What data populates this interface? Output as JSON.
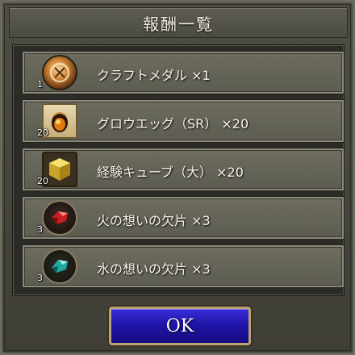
{
  "dialog": {
    "title": "報酬一覧",
    "ok_label": "OK"
  },
  "rewards": [
    {
      "label": "クラフトメダル ×1",
      "count": "1",
      "icon": "craft-medal-icon"
    },
    {
      "label": "グロウエッグ（SR） ×20",
      "count": "20",
      "icon": "grow-egg-icon"
    },
    {
      "label": "経験キューブ（大） ×20",
      "count": "20",
      "icon": "exp-cube-icon"
    },
    {
      "label": "火の想いの欠片 ×3",
      "count": "3",
      "icon": "fire-fragment-icon"
    },
    {
      "label": "水の想いの欠片 ×3",
      "count": "3",
      "icon": "water-fragment-icon"
    }
  ],
  "colors": {
    "button": "#1f14a8",
    "button_border": "#b9a374",
    "panel": "#4e4d43"
  }
}
